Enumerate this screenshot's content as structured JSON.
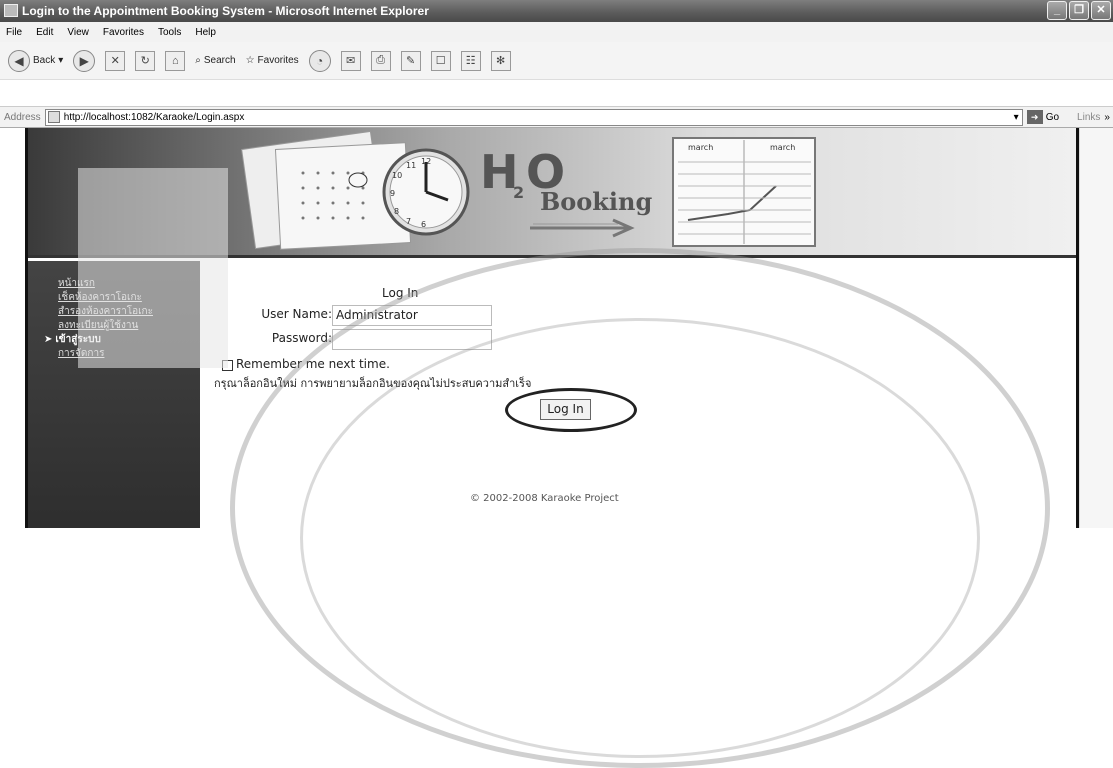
{
  "window": {
    "title": "Login to the Appointment Booking System - Microsoft Internet Explorer",
    "buttons": [
      "_",
      "❐",
      "✕"
    ]
  },
  "menubar": [
    "File",
    "Edit",
    "View",
    "Favorites",
    "Tools",
    "Help"
  ],
  "toolbar": {
    "back": "Back",
    "search": "Search",
    "favorites": "Favorites"
  },
  "address": {
    "label": "Address",
    "url": "http://localhost:1082/Karaoke/Login.aspx",
    "go": "Go",
    "links": "Links"
  },
  "banner": {
    "logo_h": "H",
    "logo_sub": "2",
    "logo_o": "O",
    "logo_booking": "Booking",
    "calendar_col1": "march",
    "calendar_col2": "march",
    "clock_numbers": [
      "12",
      "11",
      "10",
      "9",
      "8",
      "7",
      "6"
    ]
  },
  "sidebar": {
    "items": [
      "หน้าแรก",
      "เช็คห้องคาราโอเกะ",
      "สำรองห้องคาราโอเกะ",
      "ลงทะเบียนผู้ใช้งาน",
      "เข้าสู่ระบบ",
      "การจัดการ"
    ],
    "current_marker": "➤"
  },
  "login": {
    "title": "Log In",
    "username_label": "User Name:",
    "username_value": "Administrator",
    "password_label": "Password:",
    "password_value": "",
    "remember_label": "Remember me next time.",
    "failure_text": "กรุณาล็อกอินใหม่ การพยายามล็อกอินของคุณไม่ประสบความสำเร็จ",
    "button_label": "Log In"
  },
  "footer": "© 2002-2008 Karaoke Project"
}
